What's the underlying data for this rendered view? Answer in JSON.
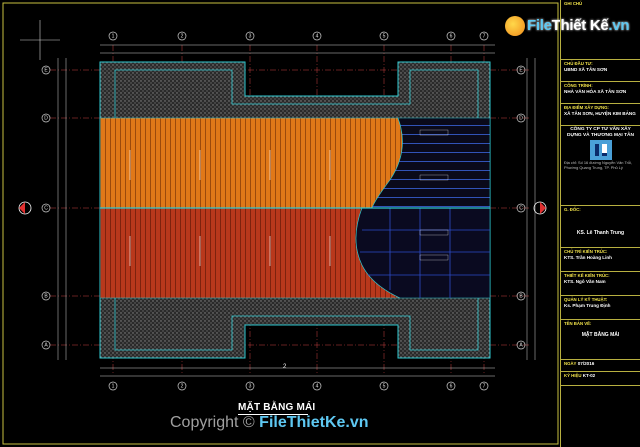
{
  "drawing": {
    "title": "MẶT BẰNG MÁI",
    "grid_labels_top": [
      "1",
      "2",
      "3",
      "4",
      "5",
      "6",
      "7"
    ],
    "grid_labels_left": [
      "E",
      "D",
      "C",
      "B",
      "A"
    ],
    "center_mark": "2",
    "colors": {
      "background": "#000000",
      "roof_orange": "#e07818",
      "roof_red": "#b8381c",
      "outline": "#2ec8d0",
      "hatch": "#9a9a9a",
      "blue_glass": "#2c4cc8",
      "dim_line": "#d0d0d0",
      "grid_line": "#e05050"
    }
  },
  "brand": {
    "name_part1": "File",
    "name_part2": "Thiết Kế",
    "name_part3": ".vn",
    "copyright_symbol": "Copyright ©",
    "copyright_site": "FileThietKe.vn"
  },
  "title_block": {
    "row1_label": "GHI CHÚ",
    "row2_label": "CHỦ ĐẦU TƯ:",
    "row2_value": "UBND XÃ TÂN SƠN",
    "row3_label": "CÔNG TRÌNH:",
    "row3_value": "NHÀ VĂN HÓA XÃ TÂN SƠN",
    "row4_label": "ĐỊA ĐIỂM XÂY DỰNG:",
    "row4_value": "XÃ TÂN SƠN, HUYỆN KIM BẢNG",
    "company": "CÔNG TY CP TƯ VẤN XÂY DỰNG VÀ THƯƠNG MẠI TÂN",
    "company_address": "Địa chỉ: Số 16 đường Nguyễn Văn Trỗi, Phường Quang Trung, TP. Phủ Lý",
    "row5_label": "G. ĐỐC:",
    "row5_value": "KS. Lê Thanh Trung",
    "row6_label": "CHỦ TRÌ KIẾN TRÚC:",
    "row6_value": "KTS. Trần Hoàng Linh",
    "row7_label": "THIẾT KẾ KIẾN TRÚC:",
    "row7_value": "KTS. Ngô Văn Nam",
    "row8_label": "QUẢN LÝ KỸ THUẬT:",
    "row8_value": "Ks. Phạm Trung Định",
    "row9_label": "TÊN BẢN VẼ:",
    "row9_value": "MẶT BẰNG MÁI",
    "row10_label": "NGÀY",
    "row10_value": "07/2016",
    "row11_label": "KÝ HIỆU",
    "row11_value": "KT-02"
  }
}
